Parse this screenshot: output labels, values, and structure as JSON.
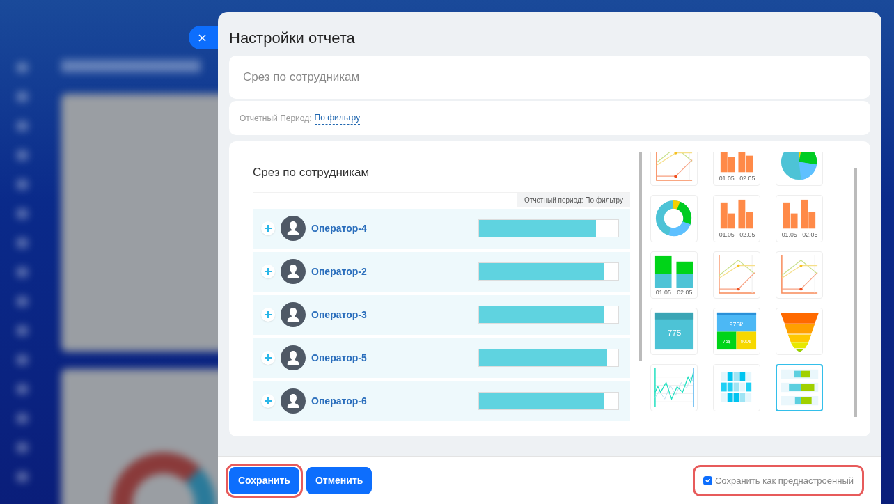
{
  "title": "Настройки отчета",
  "name_field": {
    "value": "Срез по сотрудникам"
  },
  "period": {
    "label": "Отчетный Период:",
    "link": "По фильтру"
  },
  "preview": {
    "title": "Срез по сотрудникам",
    "period_tag": "Отчетный период: По фильтру",
    "rows": [
      {
        "name": "Оператор-4",
        "level": 0.84
      },
      {
        "name": "Оператор-2",
        "level": 0.9
      },
      {
        "name": "Оператор-3",
        "level": 0.9
      },
      {
        "name": "Оператор-5",
        "level": 0.92
      },
      {
        "name": "Оператор-6",
        "level": 0.9
      }
    ]
  },
  "chart_types": [
    {
      "kind": "line",
      "selected": false
    },
    {
      "kind": "bar",
      "selected": false,
      "labels": [
        "01.05",
        "02.05"
      ]
    },
    {
      "kind": "pie",
      "selected": false
    },
    {
      "kind": "donut",
      "selected": false
    },
    {
      "kind": "bar",
      "selected": false,
      "labels": [
        "01.05",
        "02.05"
      ]
    },
    {
      "kind": "bar",
      "selected": false,
      "labels": [
        "01.05",
        "02.05"
      ]
    },
    {
      "kind": "stacked",
      "selected": false,
      "labels": [
        "01.05",
        "02.05"
      ]
    },
    {
      "kind": "line",
      "selected": false
    },
    {
      "kind": "line",
      "selected": false
    },
    {
      "kind": "number",
      "selected": false,
      "values": [
        "775"
      ]
    },
    {
      "kind": "multinumber",
      "selected": false,
      "values": [
        "975₽",
        "75$",
        "900€"
      ]
    },
    {
      "kind": "funnel",
      "selected": false
    },
    {
      "kind": "wave",
      "selected": false
    },
    {
      "kind": "heatmap",
      "selected": false
    },
    {
      "kind": "hbar",
      "selected": true
    }
  ],
  "footer": {
    "save": {
      "label": "Сохранить",
      "highlighted": true
    },
    "cancel": {
      "label": "Отменить",
      "highlighted": false
    },
    "preset": {
      "label": "Сохранить как преднастроенный",
      "checked": true,
      "highlighted": true
    }
  }
}
